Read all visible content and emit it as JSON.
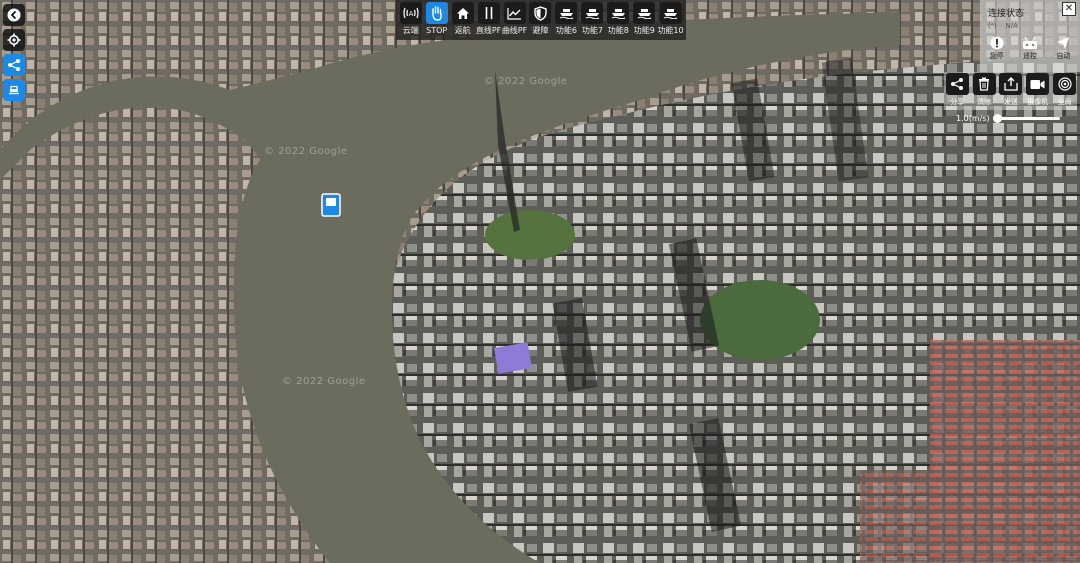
{
  "map": {
    "watermarks": [
      "© 2022 Google",
      "© 2022 Google",
      "© 2022 Google"
    ]
  },
  "sidebar": {
    "items": [
      {
        "icon": "back-arrow-icon"
      },
      {
        "icon": "gear-icon"
      },
      {
        "icon": "share-icon"
      },
      {
        "icon": "boat-icon"
      }
    ]
  },
  "toolbar": {
    "items": [
      {
        "label": "云端",
        "icon": "antenna-icon",
        "active": false
      },
      {
        "label": "STOP",
        "icon": "hand-stop-icon",
        "active": true
      },
      {
        "label": "返航",
        "icon": "home-icon",
        "active": false
      },
      {
        "label": "直线PF",
        "icon": "straight-path-icon",
        "active": false
      },
      {
        "label": "曲线PF",
        "icon": "curve-path-icon",
        "active": false
      },
      {
        "label": "避障",
        "icon": "shield-icon",
        "active": false
      },
      {
        "label": "功能6",
        "icon": "boat-icon",
        "active": false
      },
      {
        "label": "功能7",
        "icon": "boat-icon",
        "active": false
      },
      {
        "label": "功能8",
        "icon": "boat-icon",
        "active": false
      },
      {
        "label": "功能9",
        "icon": "boat-icon",
        "active": false
      },
      {
        "label": "功能10",
        "icon": "boat-icon",
        "active": false
      }
    ]
  },
  "status": {
    "title": "连接状态",
    "row": [
      "(ᴬ)",
      "N/A"
    ],
    "controls": [
      {
        "label": "急停",
        "icon": "alert-icon"
      },
      {
        "label": "遥控",
        "icon": "remote-icon"
      },
      {
        "label": "自动",
        "icon": "send-icon"
      }
    ]
  },
  "actions": {
    "items": [
      {
        "label": "分享",
        "icon": "share-icon"
      },
      {
        "label": "清除",
        "icon": "trash-icon"
      },
      {
        "label": "发送",
        "icon": "upload-icon"
      },
      {
        "label": "摄像机",
        "icon": "video-icon"
      },
      {
        "label": "全局",
        "icon": "target-icon"
      }
    ],
    "speed_label": "1.0(m/s)",
    "speed_fraction": 0.05
  },
  "colors": {
    "accent": "#1e88e5",
    "river": "#6b6b5e",
    "toolbar_bg": "#232323"
  }
}
